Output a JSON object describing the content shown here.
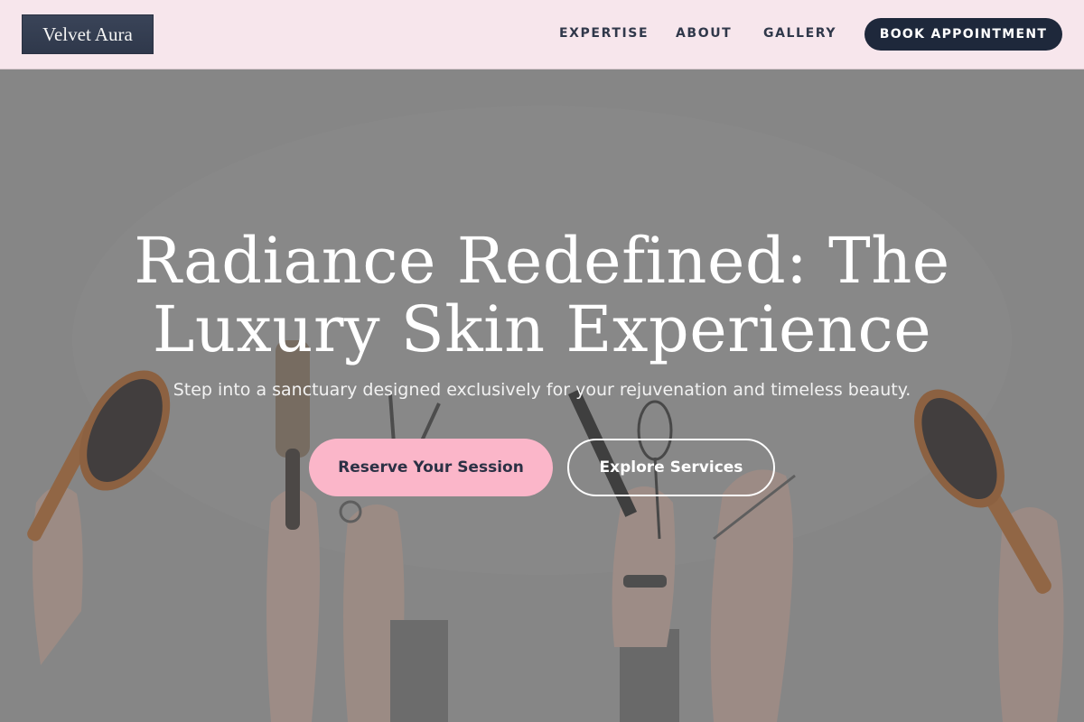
{
  "brand": {
    "name": "Velvet Aura"
  },
  "nav": {
    "items": [
      {
        "label": "EXPERTISE"
      },
      {
        "label": "ABOUT"
      },
      {
        "label": "GALLERY"
      }
    ],
    "cta_label": "BOOK APPOINTMENT"
  },
  "hero": {
    "title": "Radiance Redefined: The Luxury Skin Experience",
    "subtitle": "Step into a sanctuary designed exclusively for your rejuvenation and timeless beauty.",
    "primary_button": "Reserve Your Session",
    "secondary_button": "Explore Services",
    "image_icons": [
      "hairbrush-icon",
      "round-brush-icon",
      "scissors-icon",
      "tint-brush-icon",
      "whisk-icon",
      "comb-icon"
    ]
  },
  "colors": {
    "nav_background": "#f7e6ec",
    "brand_dark": "#1e283b",
    "accent_pink": "#fbb6c9",
    "hero_overlay": "#8c8c8c"
  }
}
